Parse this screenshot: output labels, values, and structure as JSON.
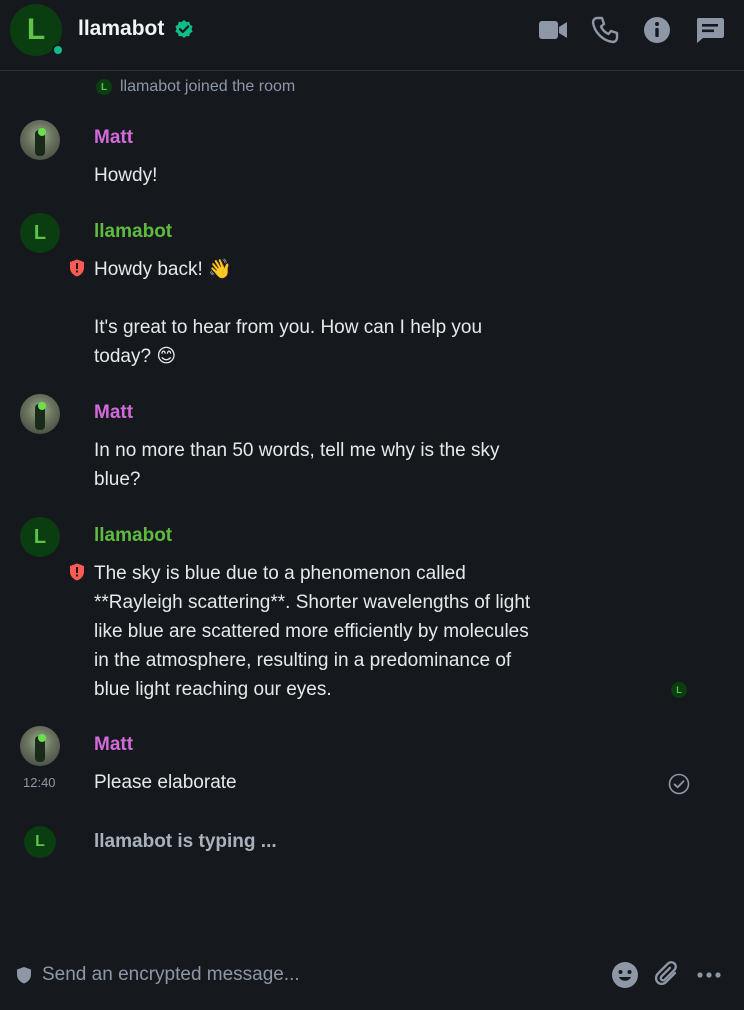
{
  "room": {
    "name": "llamabot",
    "avatar_letter": "L"
  },
  "header_icons": [
    "video-call-icon",
    "voice-call-icon",
    "room-info-icon",
    "threads-icon"
  ],
  "timeline": {
    "joined_text": "llamabot joined the room",
    "messages": [
      {
        "sender": "Matt",
        "lines": [
          "Howdy!"
        ]
      },
      {
        "sender": "llamabot",
        "lines": [
          "Howdy back! 👋",
          "It's great to hear from you. How can I help you today? 😊"
        ]
      },
      {
        "sender": "Matt",
        "lines": [
          "In no more than 50 words, tell me why is the sky blue?"
        ]
      },
      {
        "sender": "llamabot",
        "lines": [
          "The sky is blue due to a phenomenon called **Rayleigh scattering**. Shorter wavelengths of light like blue are scattered more efficiently by molecules in the atmosphere, resulting in a predominance of blue light reaching our eyes."
        ]
      },
      {
        "sender": "Matt",
        "lines": [
          "Please elaborate"
        ],
        "timestamp": "12:40"
      }
    ],
    "typing": "llamabot is typing ..."
  },
  "composer": {
    "placeholder": "Send an encrypted message..."
  },
  "colors": {
    "accent_green": "#0dbd8b",
    "matt": "#d36ad9",
    "bot": "#5fbb3f"
  }
}
